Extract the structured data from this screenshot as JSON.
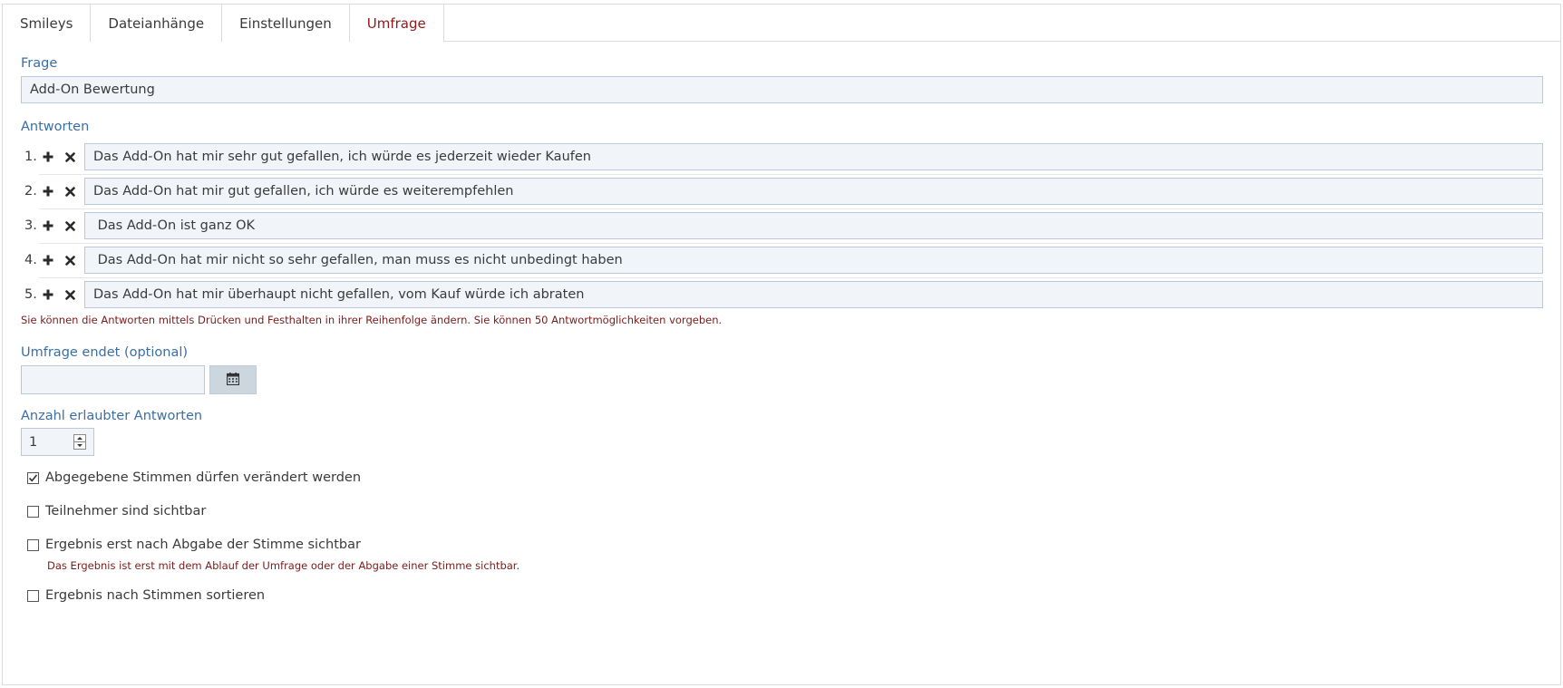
{
  "tabs": [
    {
      "label": "Smileys",
      "active": false
    },
    {
      "label": "Dateianhänge",
      "active": false
    },
    {
      "label": "Einstellungen",
      "active": false
    },
    {
      "label": "Umfrage",
      "active": true
    }
  ],
  "question": {
    "label": "Frage",
    "value": "Add-On Bewertung"
  },
  "answers": {
    "label": "Antworten",
    "items": [
      {
        "number": "1.",
        "text": "Das Add-On hat mir sehr gut gefallen, ich würde es jederzeit wieder Kaufen"
      },
      {
        "number": "2.",
        "text": "Das Add-On hat mir gut gefallen, ich würde es weiterempfehlen"
      },
      {
        "number": "3.",
        "text": " Das Add-On ist ganz OK"
      },
      {
        "number": "4.",
        "text": " Das Add-On hat mir nicht so sehr gefallen, man muss es nicht unbedingt haben"
      },
      {
        "number": "5.",
        "text": "Das Add-On hat mir überhaupt nicht gefallen, vom Kauf würde ich abraten"
      }
    ],
    "hint": "Sie können die Antworten mittels Drücken und Festhalten in ihrer Reihenfolge ändern. Sie können 50 Antwortmöglichkeiten vorgeben."
  },
  "end_date": {
    "label": "Umfrage endet (optional)",
    "value": ""
  },
  "allowed_answers": {
    "label": "Anzahl erlaubter Antworten",
    "value": "1"
  },
  "options": [
    {
      "label": "Abgegebene Stimmen dürfen verändert werden",
      "checked": true
    },
    {
      "label": "Teilnehmer sind sichtbar",
      "checked": false
    },
    {
      "label": "Ergebnis erst nach Abgabe der Stimme sichtbar",
      "checked": false,
      "hint": "Das Ergebnis ist erst mit dem Ablauf der Umfrage oder der Abgabe einer Stimme sichtbar."
    },
    {
      "label": "Ergebnis nach Stimmen sortieren",
      "checked": false
    }
  ],
  "colors": {
    "active_tab": "#8b1a1a",
    "label": "#3a6ea8",
    "hint": "#7a1b1b",
    "field_bg": "#f1f5fa",
    "field_border": "#b9c9d9"
  },
  "icons": {
    "add": "plus-icon",
    "remove": "close-icon",
    "calendar": "calendar-icon"
  }
}
